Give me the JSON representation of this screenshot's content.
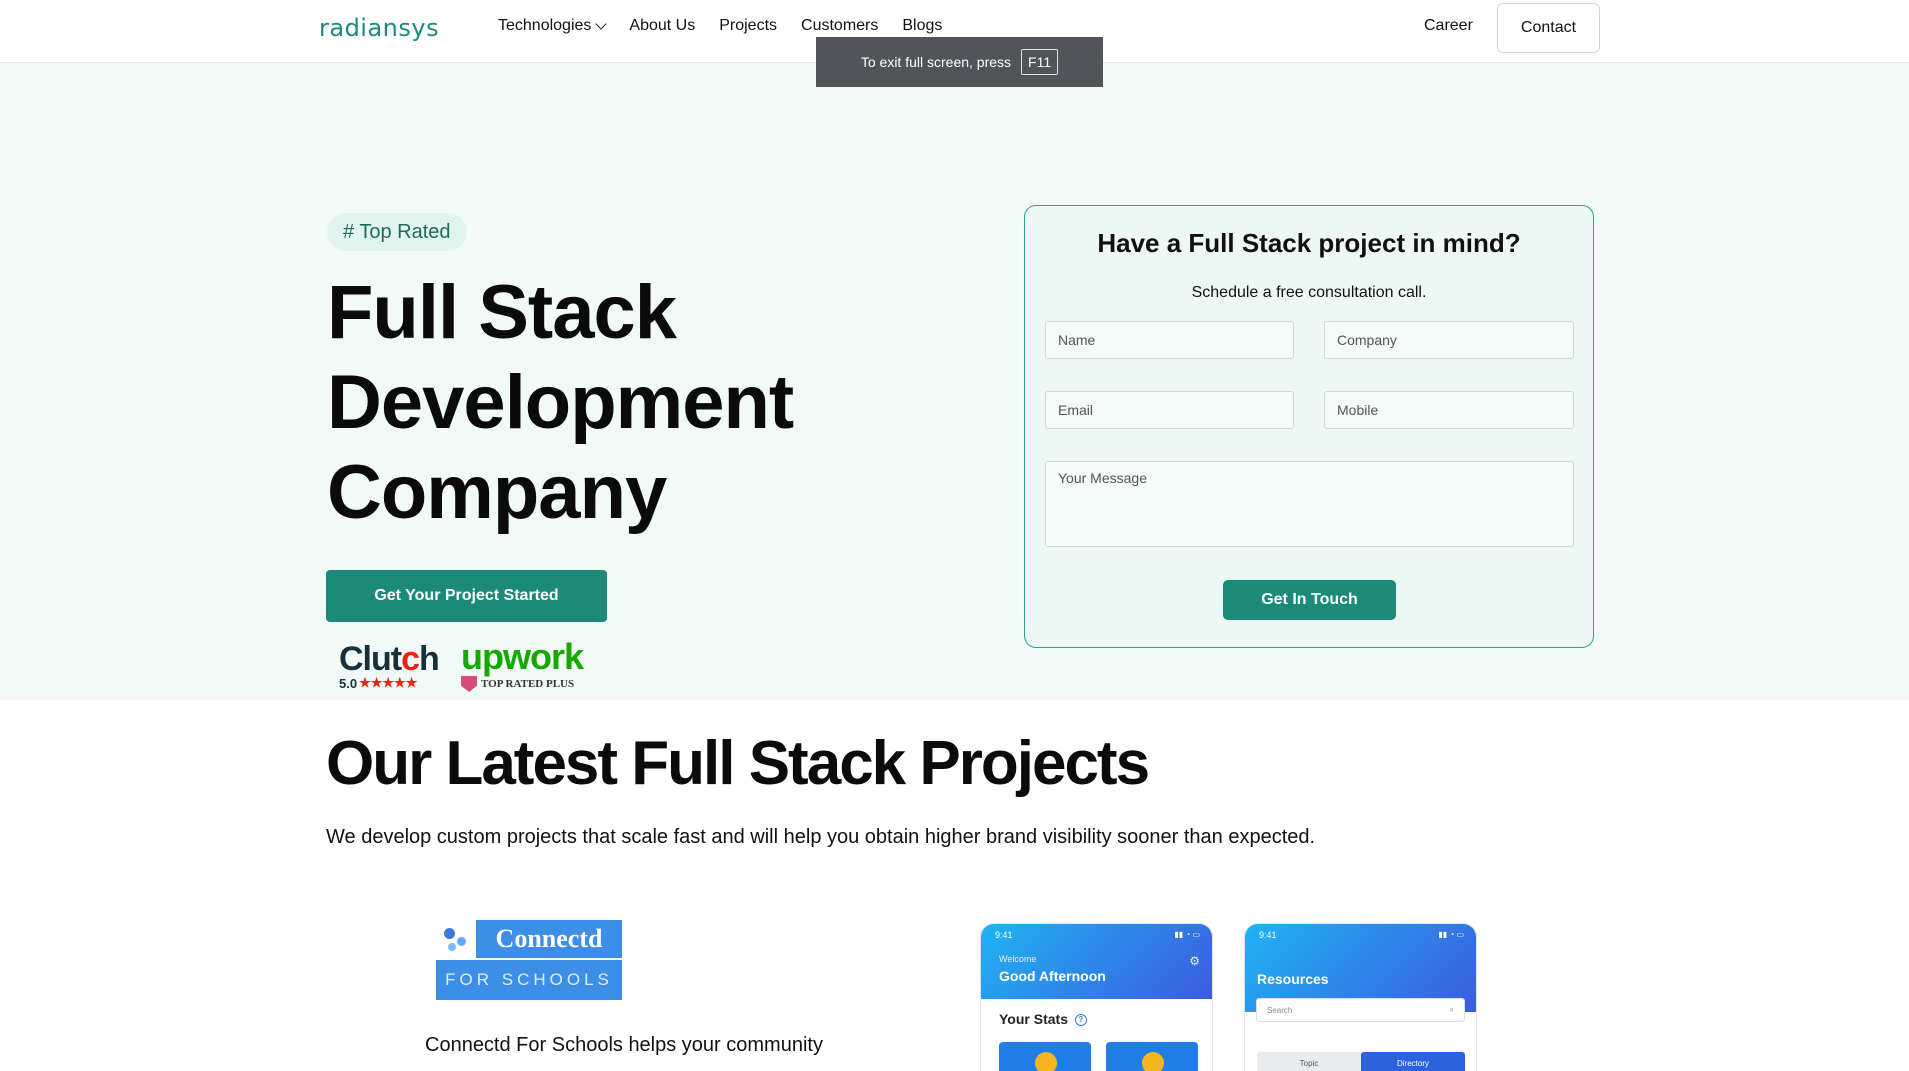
{
  "brand": {
    "logo": "radiansys"
  },
  "nav": {
    "technologies": "Technologies",
    "about": "About Us",
    "projects": "Projects",
    "customers": "Customers",
    "blogs": "Blogs",
    "career": "Career",
    "contact": "Contact"
  },
  "fullscreen_toast": {
    "text": "To exit full screen, press",
    "key": "F11"
  },
  "hero": {
    "badge": "# Top Rated",
    "title_lines": [
      "Full Stack",
      "Development",
      "Company"
    ],
    "cta": "Get Your Project Started",
    "clutch": {
      "name_a": "Clut",
      "name_dot": "c",
      "name_b": "h",
      "rating": "5.0",
      "stars": "★★★★★"
    },
    "upwork": {
      "name": "upwork",
      "badge": "TOP RATED PLUS"
    }
  },
  "form": {
    "title": "Have a Full Stack project in mind?",
    "subtitle": "Schedule a free consultation call.",
    "name_placeholder": "Name",
    "company_placeholder": "Company",
    "email_placeholder": "Email",
    "mobile_placeholder": "Mobile",
    "message_placeholder": "Your Message",
    "submit": "Get In Touch"
  },
  "projects": {
    "title": "Our Latest Full Stack Projects",
    "subtitle": "We develop custom projects that scale fast and will help you obtain higher brand visibility sooner than expected.",
    "item1": {
      "logo_name": "Connectd",
      "logo_sub": "FOR SCHOOLS",
      "description": "Connectd For Schools helps your community"
    },
    "phone1": {
      "time": "9:41",
      "icons": "▮▮ ◔ ▭",
      "welcome": "Welcome",
      "greeting": "Good Afternoon",
      "stats": "Your Stats",
      "help": "?"
    },
    "phone2": {
      "time": "9:41",
      "icons": "▮▮ ◔ ▭",
      "title": "Resources",
      "search": "Search",
      "tab1": "Topic",
      "tab2": "Directory"
    }
  },
  "colors": {
    "accent": "#1b8a78",
    "hero_bg": "#f1faf7",
    "border": "#2aa58e"
  }
}
